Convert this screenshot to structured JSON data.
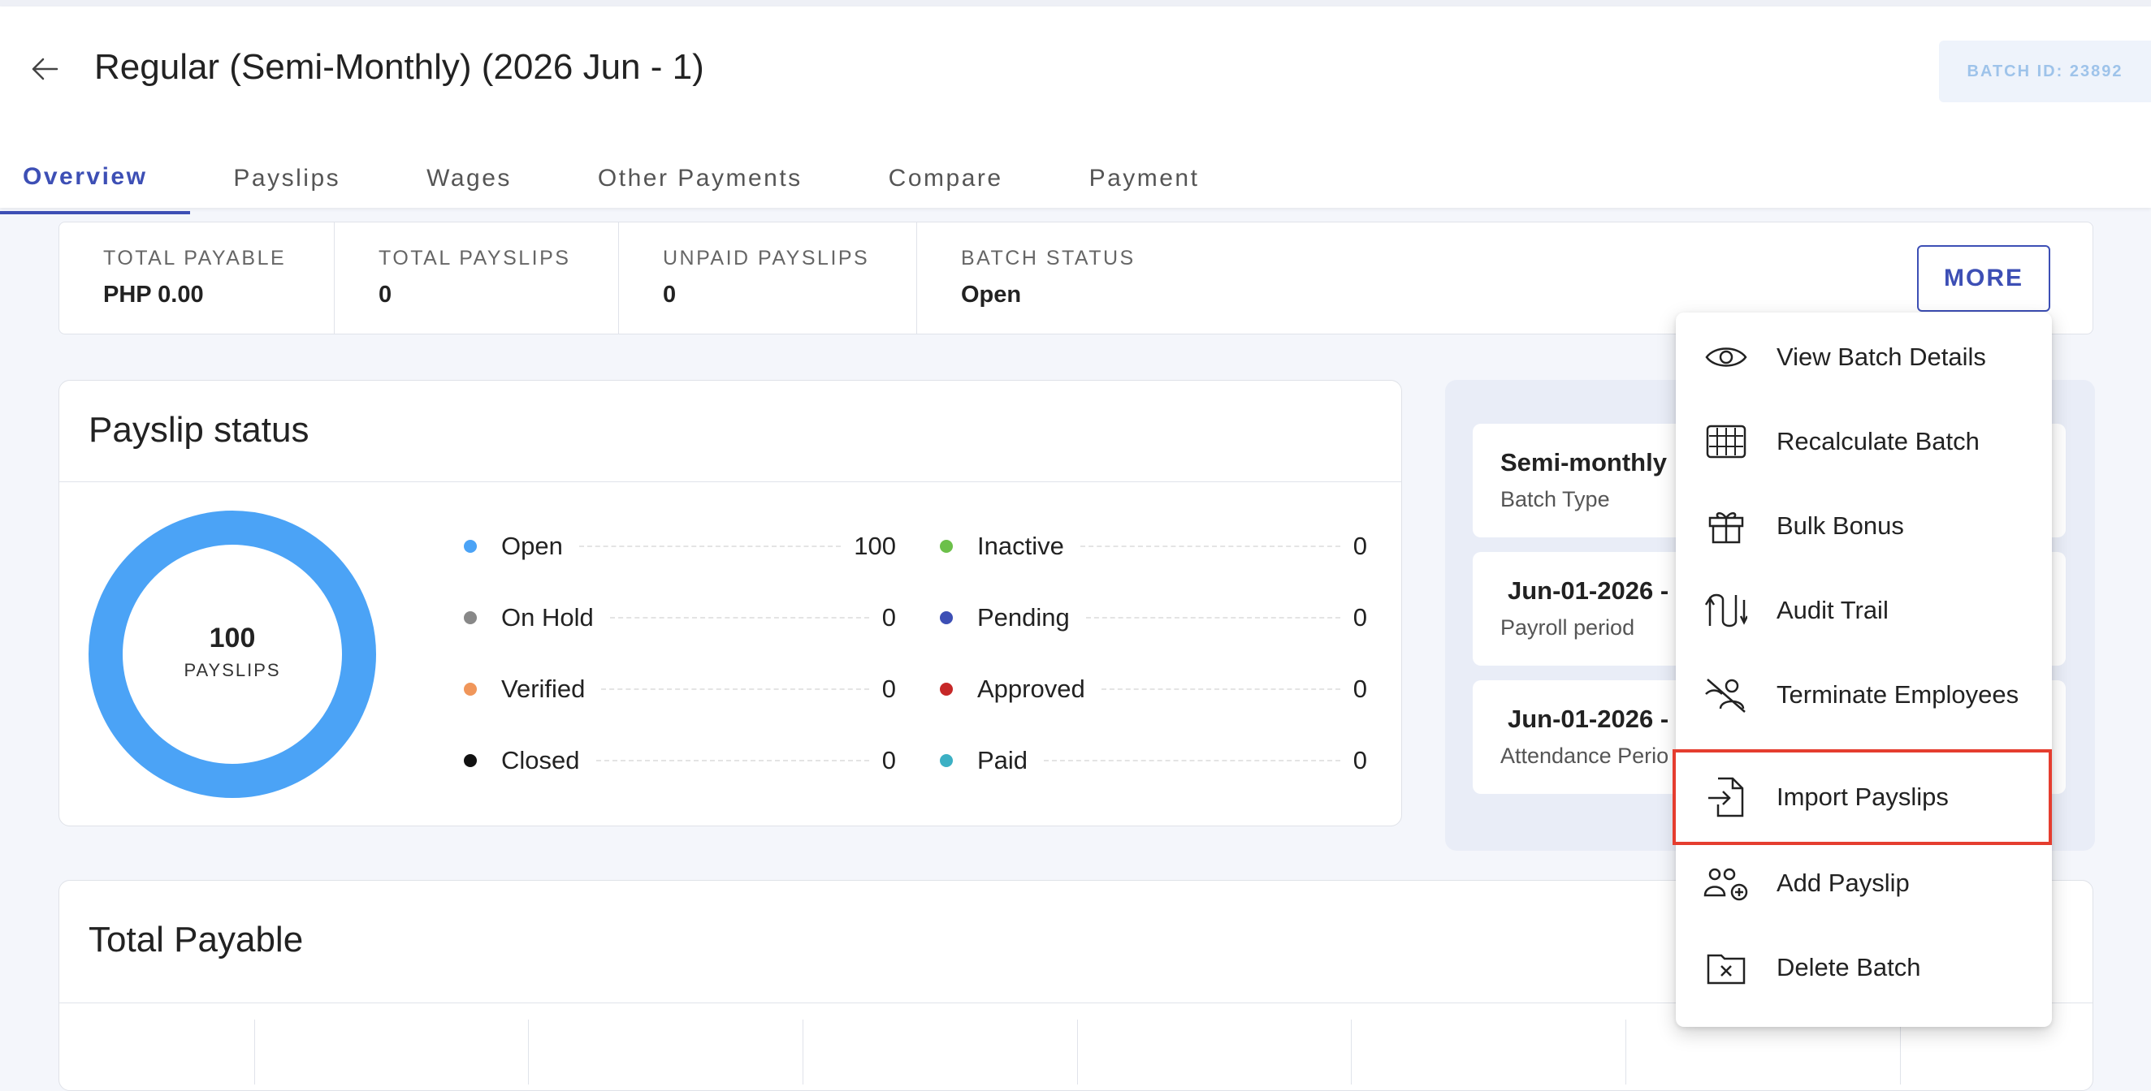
{
  "header": {
    "title": "Regular (Semi-Monthly) (2026 Jun - 1)",
    "batch_id": "BATCH ID: 23892"
  },
  "tabs": [
    {
      "label": "Overview",
      "active": true
    },
    {
      "label": "Payslips"
    },
    {
      "label": "Wages"
    },
    {
      "label": "Other Payments"
    },
    {
      "label": "Compare"
    },
    {
      "label": "Payment"
    }
  ],
  "summary": {
    "total_payable_label": "TOTAL PAYABLE",
    "total_payable_value": "PHP 0.00",
    "total_payslips_label": "TOTAL PAYSLIPS",
    "total_payslips_value": "0",
    "unpaid_payslips_label": "UNPAID PAYSLIPS",
    "unpaid_payslips_value": "0",
    "batch_status_label": "BATCH STATUS",
    "batch_status_value": "Open",
    "more_label": "MORE"
  },
  "payslip_status": {
    "title": "Payslip status",
    "center_value": "100",
    "center_label": "PAYSLIPS",
    "legend": [
      {
        "name": "Open",
        "value": "100",
        "color": "#4ba3f6"
      },
      {
        "name": "On Hold",
        "value": "0",
        "color": "#888888"
      },
      {
        "name": "Verified",
        "value": "0",
        "color": "#f0965a"
      },
      {
        "name": "Closed",
        "value": "0",
        "color": "#111111"
      },
      {
        "name": "Inactive",
        "value": "0",
        "color": "#6cc04a"
      },
      {
        "name": "Pending",
        "value": "0",
        "color": "#3d4fb5"
      },
      {
        "name": "Approved",
        "value": "0",
        "color": "#c62828"
      },
      {
        "name": "Paid",
        "value": "0",
        "color": "#3cb0c4"
      }
    ]
  },
  "batch_info": [
    {
      "main": "Semi-monthly",
      "sub": "Batch Type"
    },
    {
      "main": "Jun-01-2026 -",
      "sub": "Payroll period"
    },
    {
      "main": "Jun-01-2026 -",
      "sub": "Attendance Perio"
    }
  ],
  "total_payable": {
    "title": "Total Payable"
  },
  "more_menu": {
    "items": [
      {
        "label": "View Batch Details",
        "icon": "eye-icon"
      },
      {
        "label": "Recalculate Batch",
        "icon": "calculator-icon"
      },
      {
        "label": "Bulk Bonus",
        "icon": "gift-icon"
      },
      {
        "label": "Audit Trail",
        "icon": "audit-trail-icon"
      },
      {
        "label": "Terminate Employees",
        "icon": "terminate-user-icon"
      },
      {
        "label": "Import Payslips",
        "icon": "file-import-icon",
        "highlighted": true
      },
      {
        "label": "Add Payslip",
        "icon": "add-users-icon"
      },
      {
        "label": "Delete Batch",
        "icon": "folder-delete-icon"
      }
    ]
  },
  "colors": {
    "accent": "#3d4fb5",
    "donut": "#4ba3f6",
    "highlight_border": "#e53d2f"
  }
}
